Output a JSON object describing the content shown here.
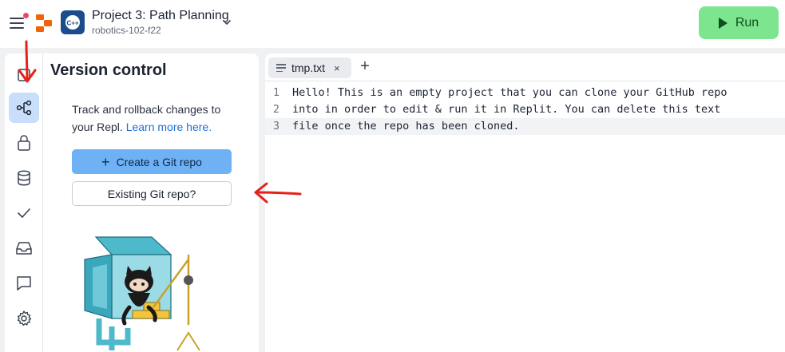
{
  "header": {
    "project_title": "Project 3: Path Planning",
    "project_subtitle": "robotics-102-f22",
    "language_icon_text": "C++",
    "run_label": "Run",
    "icons": [
      "menu-icon",
      "notification-dot",
      "replit-logo",
      "cpp-language-icon",
      "chevron-down-icon",
      "play-icon"
    ]
  },
  "sidebar": {
    "items": [
      {
        "name": "files",
        "icon": "file-icon"
      },
      {
        "name": "version-control",
        "icon": "git-branch-icon",
        "active": true
      },
      {
        "name": "secrets",
        "icon": "lock-icon"
      },
      {
        "name": "database",
        "icon": "database-icon"
      },
      {
        "name": "tests",
        "icon": "check-icon"
      },
      {
        "name": "packages",
        "icon": "inbox-icon"
      },
      {
        "name": "chat",
        "icon": "chat-icon"
      },
      {
        "name": "settings",
        "icon": "gear-icon"
      }
    ]
  },
  "version_control": {
    "title": "Version control",
    "description": "Track and rollback changes to your Repl.",
    "learn_more": "Learn more here.",
    "create_button": "Create a Git repo",
    "existing_button": "Existing Git repo?"
  },
  "editor": {
    "tab_label": "tmp.txt",
    "tab_close": "×",
    "add_tab": "+",
    "lines": [
      {
        "no": "1",
        "text": "Hello! This is an empty project that you can clone your GitHub repo"
      },
      {
        "no": "2",
        "text": "into in order to edit & run it in Replit. You can delete this text"
      },
      {
        "no": "3",
        "text": "file once the repo has been cloned."
      }
    ]
  },
  "colors": {
    "accent_blue": "#6fb1f5",
    "run_green": "#7ee58f",
    "active_rail": "#c9defa",
    "annotation_red": "#e8201a"
  }
}
